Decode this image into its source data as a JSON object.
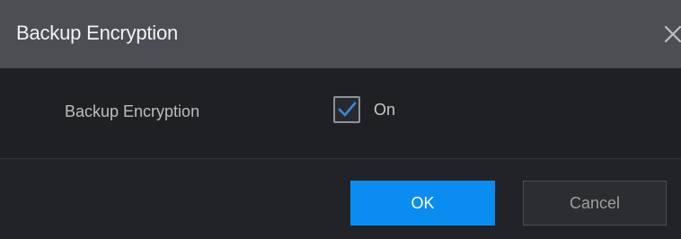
{
  "dialog": {
    "title": "Backup Encryption",
    "close_icon": "close-icon"
  },
  "form": {
    "field_label": "Backup Encryption",
    "checkbox": {
      "checked": true,
      "label": "On",
      "accent_color": "#3a86d6"
    }
  },
  "footer": {
    "ok_label": "OK",
    "cancel_label": "Cancel",
    "ok_color": "#0b8cf1"
  }
}
